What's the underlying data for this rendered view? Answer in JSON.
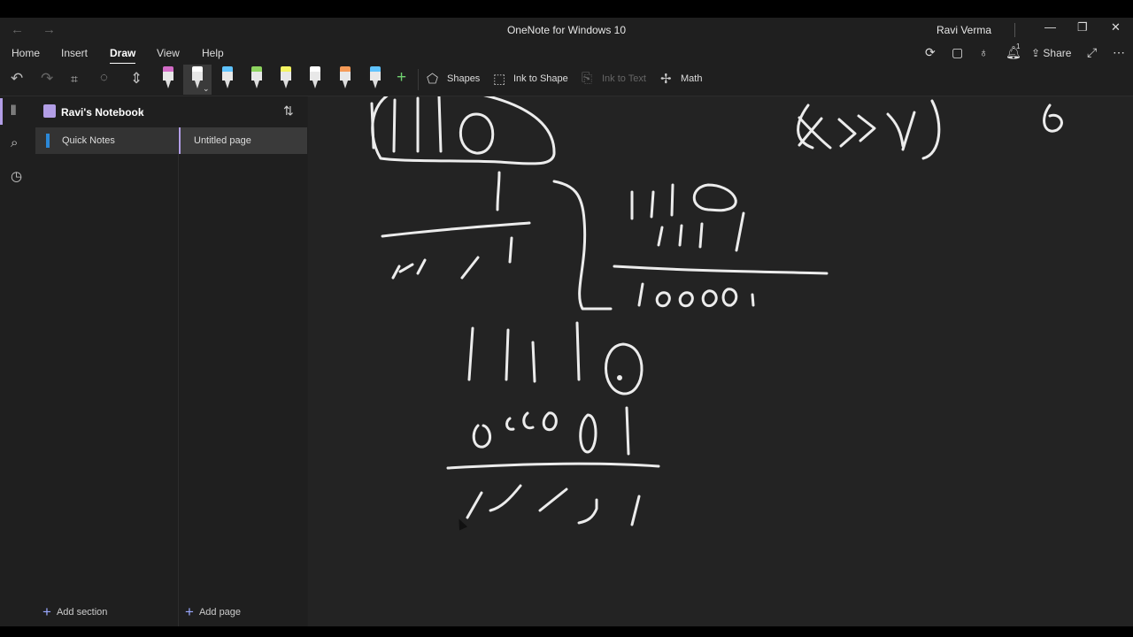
{
  "window": {
    "title": "OneNote for Windows 10",
    "user": "Ravi Verma"
  },
  "menu": {
    "tabs": [
      "Home",
      "Insert",
      "Draw",
      "View",
      "Help"
    ],
    "active_tab": "Draw",
    "share_label": "Share",
    "notification_count": "1"
  },
  "toolbar": {
    "shapes_label": "Shapes",
    "ink_to_shape_label": "Ink to Shape",
    "ink_to_text_label": "Ink to Text",
    "math_label": "Math",
    "pens": [
      {
        "cap": "#d36cc7"
      },
      {
        "cap": "#ffffff"
      },
      {
        "cap": "#5fc3ff"
      },
      {
        "cap": "#8dd35f"
      },
      {
        "cap": "#f4f462"
      },
      {
        "cap": "#ffffff"
      },
      {
        "cap": "#f59a57"
      },
      {
        "cap": "#5fc3ff"
      }
    ]
  },
  "notebook": {
    "name": "Ravi's Notebook",
    "sections": [
      {
        "label": "Quick Notes",
        "color": "#2b88d8"
      }
    ],
    "pages": [
      {
        "label": "Untitled page"
      }
    ],
    "add_section_label": "Add section",
    "add_page_label": "Add page"
  },
  "colors": {
    "accent": "#b29ee6",
    "ink": "#ececec",
    "canvas": "#232323"
  }
}
